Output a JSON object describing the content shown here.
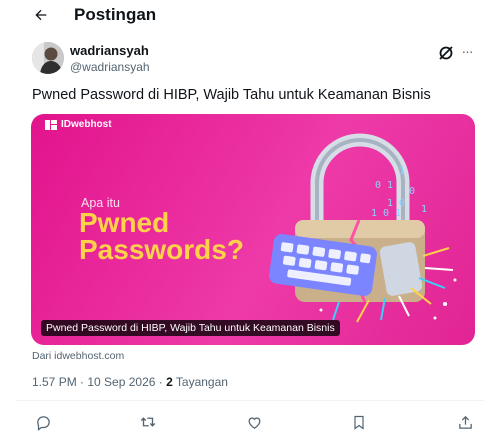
{
  "header": {
    "back_icon": "arrow-left-icon",
    "title": "Postingan"
  },
  "post": {
    "author_name": "wadriansyah",
    "author_handle": "@wadriansyah",
    "text": "Pwned Password di HIBP, Wajib Tahu untuk Keamanan Bisnis",
    "more_label": "···",
    "card": {
      "brand": "IDwebhost",
      "kicker": "Apa itu",
      "headline_1": "Pwned",
      "headline_2": "Passwords?",
      "caption": "Pwned Password di HIBP, Wajib Tahu untuk Keamanan Bisnis",
      "source": "Dari idwebhost.com"
    },
    "meta": {
      "time": "1.57 PM · 10 Sep 2026 · ",
      "views": "2",
      "views_label": " Tayangan"
    }
  },
  "actions": [
    "reply-icon",
    "repost-icon",
    "like-icon",
    "bookmark-icon",
    "share-icon"
  ],
  "colors": {
    "card_bg": "#e2138c",
    "headline": "#ffd24a",
    "muted": "#536471"
  }
}
